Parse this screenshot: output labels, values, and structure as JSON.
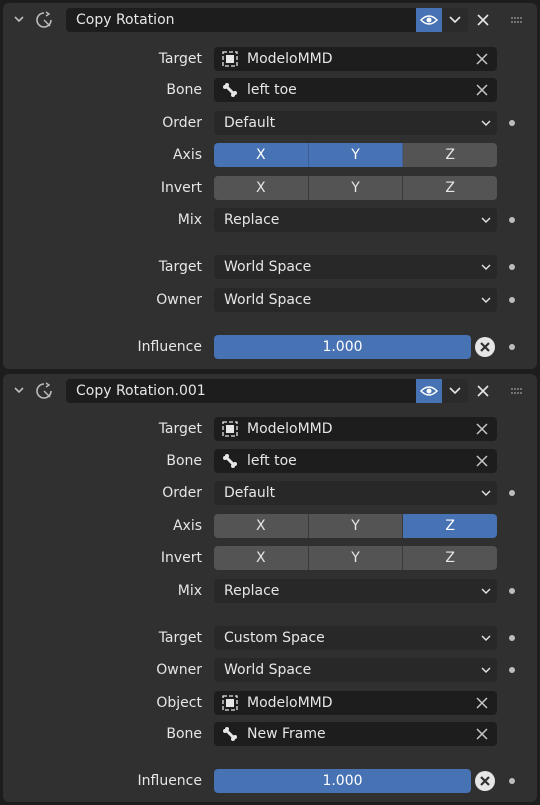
{
  "constraints": [
    {
      "name": "Copy Rotation",
      "target": {
        "label": "Target",
        "value": "ModeloMMD"
      },
      "bone": {
        "label": "Bone",
        "value": "left toe"
      },
      "order": {
        "label": "Order",
        "value": "Default"
      },
      "axis": {
        "label": "Axis",
        "x": "X",
        "y": "Y",
        "z": "Z",
        "enabled": [
          "X",
          "Y"
        ]
      },
      "invert": {
        "label": "Invert",
        "x": "X",
        "y": "Y",
        "z": "Z",
        "enabled": []
      },
      "mix": {
        "label": "Mix",
        "value": "Replace"
      },
      "target_space": {
        "label": "Target",
        "value": "World Space"
      },
      "owner_space": {
        "label": "Owner",
        "value": "World Space"
      },
      "influence": {
        "label": "Influence",
        "value": "1.000"
      }
    },
    {
      "name": "Copy Rotation.001",
      "target": {
        "label": "Target",
        "value": "ModeloMMD"
      },
      "bone": {
        "label": "Bone",
        "value": "left toe"
      },
      "order": {
        "label": "Order",
        "value": "Default"
      },
      "axis": {
        "label": "Axis",
        "x": "X",
        "y": "Y",
        "z": "Z",
        "enabled": [
          "Z"
        ]
      },
      "invert": {
        "label": "Invert",
        "x": "X",
        "y": "Y",
        "z": "Z",
        "enabled": []
      },
      "mix": {
        "label": "Mix",
        "value": "Replace"
      },
      "target_space": {
        "label": "Target",
        "value": "Custom Space"
      },
      "owner_space": {
        "label": "Owner",
        "value": "World Space"
      },
      "space_object": {
        "label": "Object",
        "value": "ModeloMMD"
      },
      "space_bone": {
        "label": "Bone",
        "value": "New Frame"
      },
      "influence": {
        "label": "Influence",
        "value": "1.000"
      }
    }
  ],
  "colors": {
    "accent": "#4772b3",
    "panel": "#303030",
    "field": "#1d1d1d"
  }
}
